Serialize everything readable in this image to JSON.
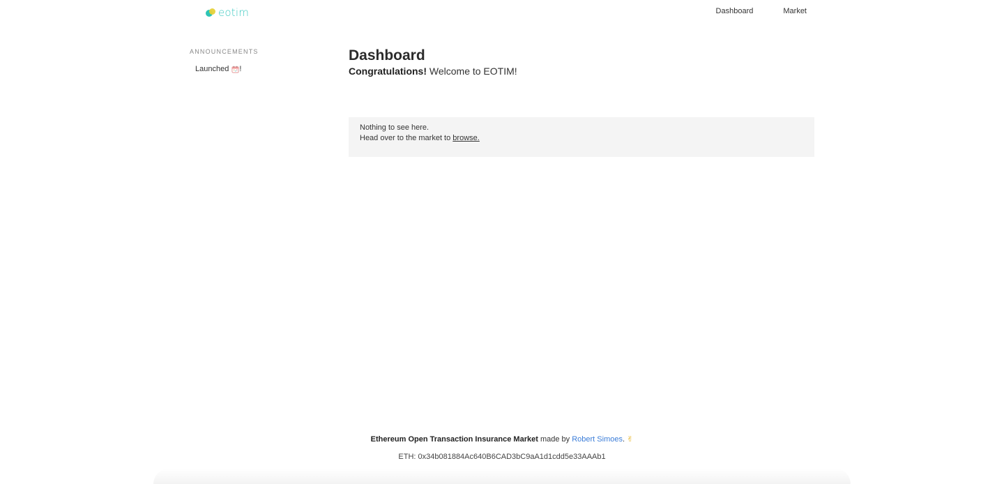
{
  "header": {
    "logo_text": "eotim",
    "nav": [
      {
        "label": "Dashboard"
      },
      {
        "label": "Market"
      }
    ]
  },
  "sidebar": {
    "heading": "ANNOUNCEMENTS",
    "items": [
      {
        "label": "Launched",
        "icon": "party-popper-icon",
        "suffix": "!"
      }
    ]
  },
  "main": {
    "title": "Dashboard",
    "subtitle_strong": "Congratulations!",
    "subtitle_rest": " Welcome to EOTIM!",
    "empty_state": {
      "line1": "Nothing to see here.",
      "line2_prefix": "Head over to the market to ",
      "link_label": "browse."
    }
  },
  "footer": {
    "project_name": "Ethereum Open Transaction Insurance Market",
    "made_by": " made by ",
    "author": "Robert Simoes",
    "period": ".",
    "icon": "victory-hand-icon",
    "eth_address": "ETH: 0x34b081884Ac640B6CAD3bC9aA1d1cdd5e33AAAb1"
  },
  "colors": {
    "logo_teal": "#3cc9c0",
    "logo_yellow": "#e6d23a",
    "link_blue": "#3b7dd8",
    "empty_box_bg": "#f4f4f4"
  }
}
